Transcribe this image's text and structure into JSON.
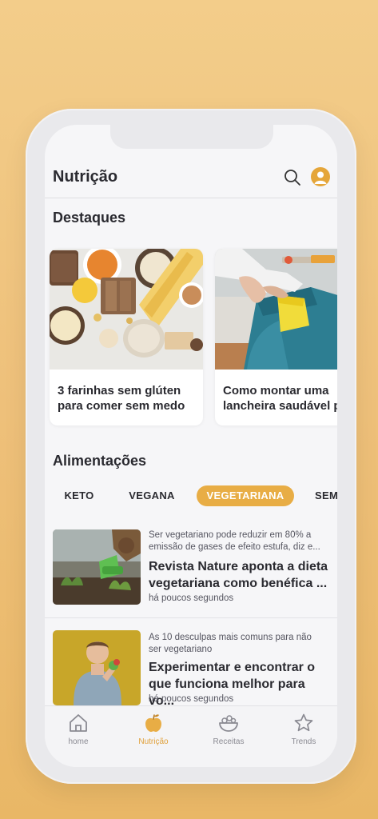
{
  "header": {
    "title": "Nutrição"
  },
  "highlights": {
    "title": "Destaques",
    "cards": [
      {
        "title": "3 farinhas sem glúten\npara comer sem medo"
      },
      {
        "title": "Como montar uma\nlancheira saudável p"
      }
    ]
  },
  "feeds": {
    "title": "Alimentações",
    "chips": [
      {
        "label": "KETO"
      },
      {
        "label": "VEGANA"
      },
      {
        "label": "VEGETARIANA",
        "active": true
      },
      {
        "label": "SEM"
      }
    ]
  },
  "articles": [
    {
      "kicker": "Ser vegetariano pode reduzir em 80% a\nemissão de gases de efeito estufa, diz e...",
      "headline": "Revista Nature aponta a dieta\nvegetariana como benéfica ...",
      "time": "há poucos segundos"
    },
    {
      "kicker": "As 10 desculpas mais comuns para não\nser vegetariano",
      "headline": "Experimentar e encontrar o\nque funciona melhor para vo...",
      "time": "há poucos segundos"
    }
  ],
  "tabbar": {
    "items": [
      {
        "label": "home",
        "icon": "house-icon"
      },
      {
        "label": "Nutrição",
        "icon": "apple-icon",
        "active": true
      },
      {
        "label": "Receitas",
        "icon": "bowl-icon"
      },
      {
        "label": "Trends",
        "icon": "star-icon"
      }
    ]
  },
  "colors": {
    "accent": "#e8ad45",
    "background": "#f0c77e",
    "text": "#2a2a30"
  }
}
